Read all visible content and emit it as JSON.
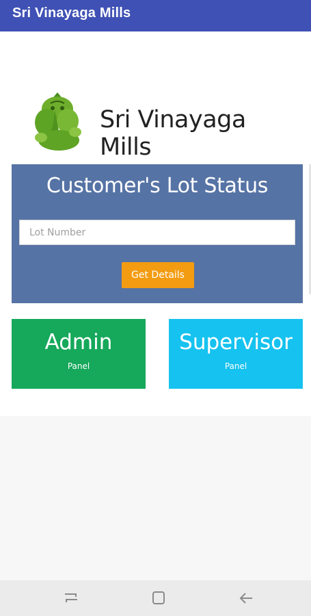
{
  "appbar": {
    "title": "Sri Vinayaga Mills"
  },
  "brand": {
    "title": "Sri Vinayaga Mills",
    "logo_icon": "ganesha-logo-icon"
  },
  "lot_status": {
    "title": "Customer's Lot Status",
    "input_placeholder": "Lot Number",
    "input_value": "",
    "button_label": "Get Details"
  },
  "panels": [
    {
      "title": "Admin",
      "subtitle": "Panel",
      "color": "#16a85b"
    },
    {
      "title": "Supervisor",
      "subtitle": "Panel",
      "color": "#16c2ef"
    }
  ],
  "navbar": {
    "icons": [
      "recent-apps-icon",
      "home-icon",
      "back-icon"
    ]
  },
  "colors": {
    "appbar": "#3f51b5",
    "card": "#5673a5",
    "button": "#f39c12"
  }
}
